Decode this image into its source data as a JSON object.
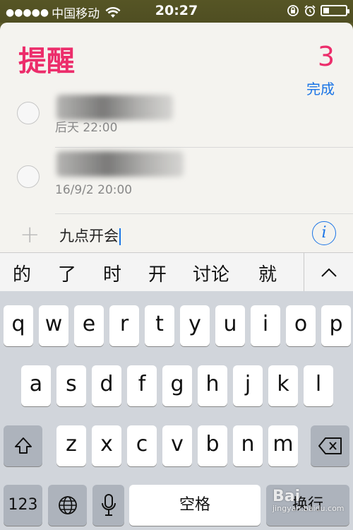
{
  "status": {
    "carrier": "中国移动",
    "time": "20:27"
  },
  "app": {
    "title": "提醒",
    "completed_count": "3",
    "done_label": "完成"
  },
  "reminders": [
    {
      "date": "后天 22:00"
    },
    {
      "date": "16/9/2 20:00"
    }
  ],
  "new_reminder": {
    "text": "九点开会"
  },
  "candidates": [
    "的",
    "了",
    "时",
    "开",
    "讨论",
    "就"
  ],
  "keyboard": {
    "row1": [
      "q",
      "w",
      "e",
      "r",
      "t",
      "y",
      "u",
      "i",
      "o",
      "p"
    ],
    "row2": [
      "a",
      "s",
      "d",
      "f",
      "g",
      "h",
      "j",
      "k",
      "l"
    ],
    "row3": [
      "z",
      "x",
      "c",
      "v",
      "b",
      "n",
      "m"
    ],
    "numbers": "123",
    "space": "空格",
    "return": "换行"
  },
  "watermark": {
    "brand": "Bai",
    "sub": "jingyan.baidu.com"
  }
}
